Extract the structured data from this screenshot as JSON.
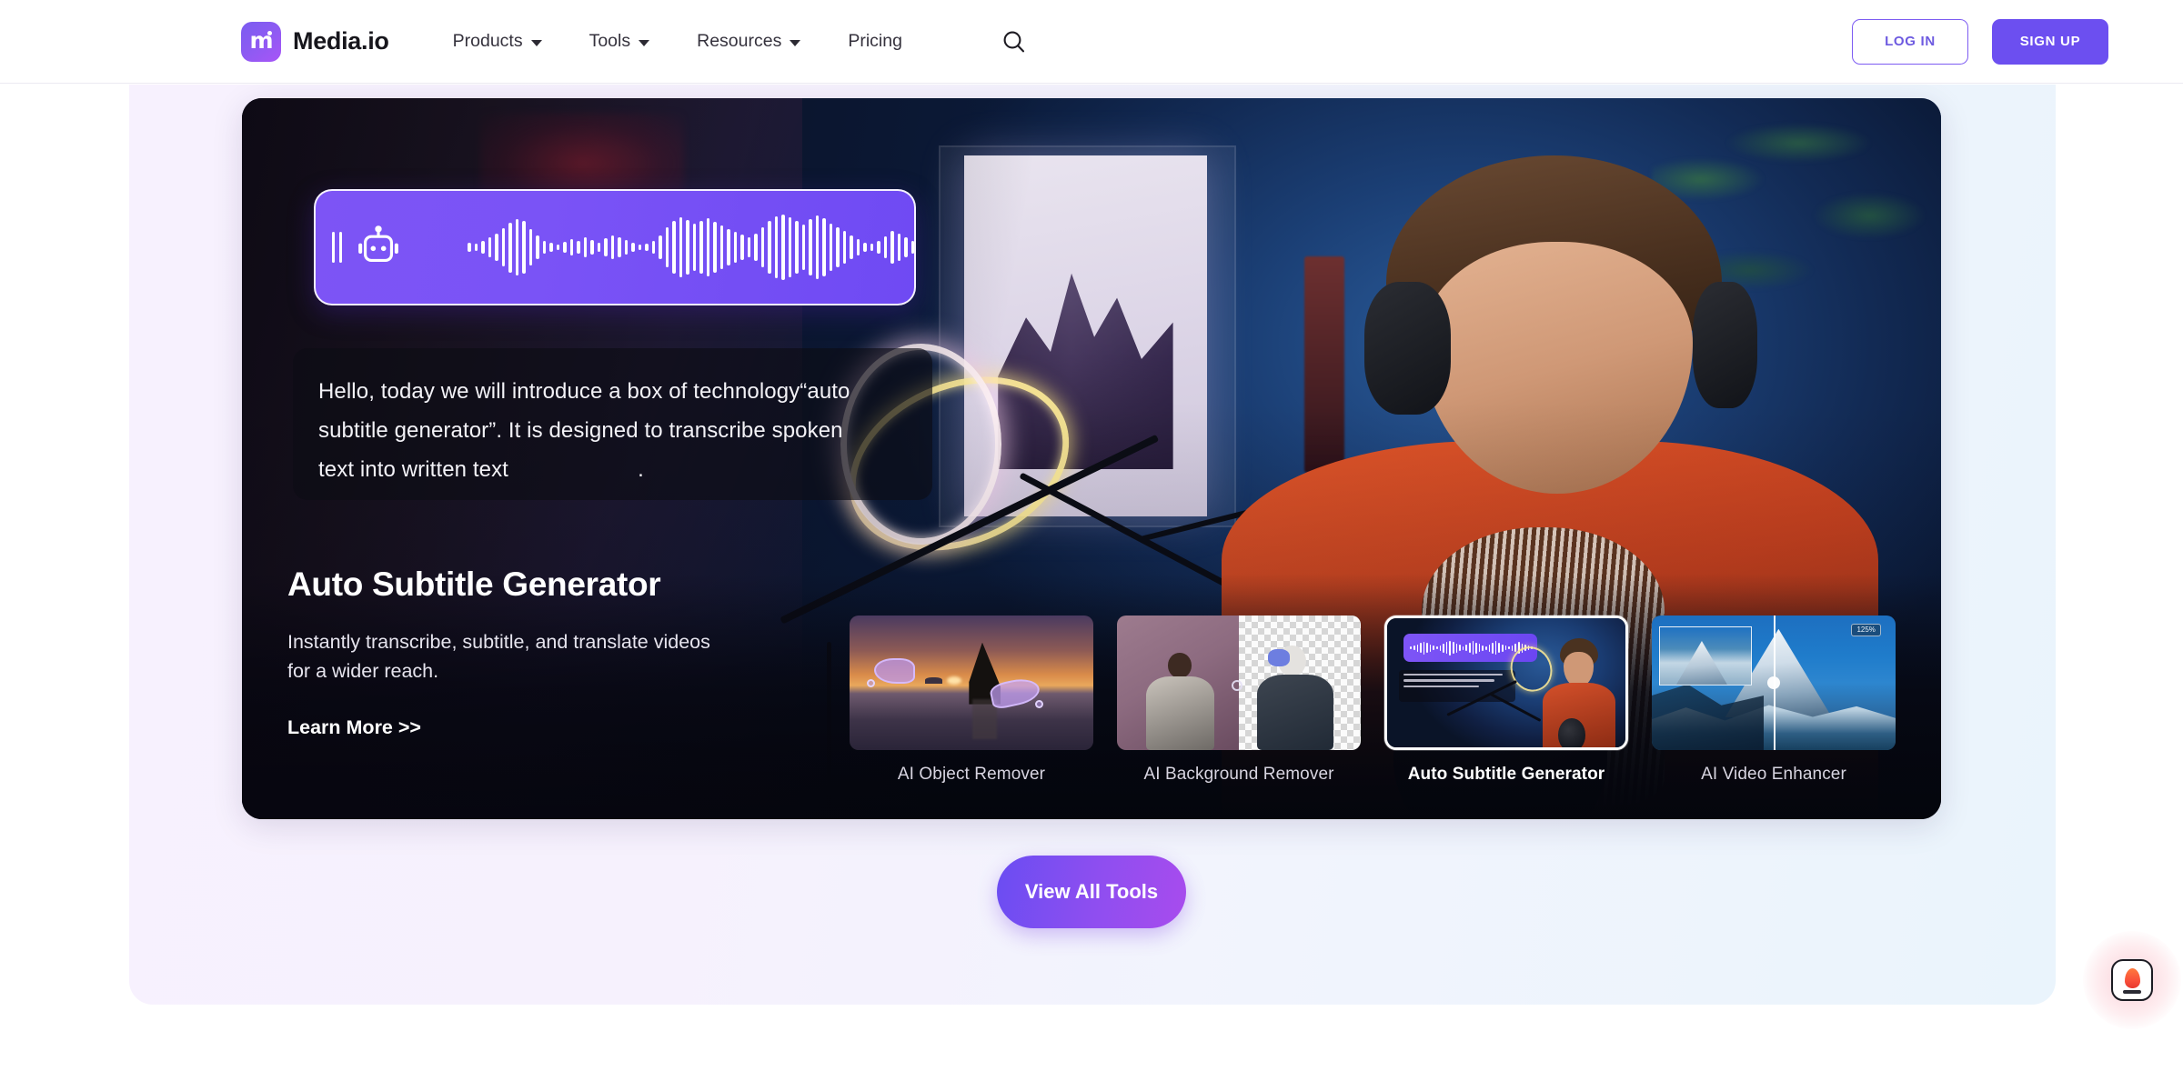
{
  "header": {
    "brand": {
      "name": "Media.io",
      "logo_icon": "media-io-logo-icon",
      "logo_letter": "m"
    },
    "nav": [
      {
        "label": "Products",
        "has_dropdown": true
      },
      {
        "label": "Tools",
        "has_dropdown": true
      },
      {
        "label": "Resources",
        "has_dropdown": true
      },
      {
        "label": "Pricing",
        "has_dropdown": false
      }
    ],
    "search_icon": "search-icon",
    "login_label": "LOG IN",
    "signup_label": "SIGN UP",
    "accent_color": "#6c4ff0",
    "login_border_color": "#7d5cf2"
  },
  "hero": {
    "waveform": {
      "robot_icon": "robot-icon",
      "card_color": "#7a53f6"
    },
    "subtitle_lines": [
      "Hello, today we will introduce a box of technology“auto",
      "subtitle generator”. It is designed to transcribe spoken",
      "text into written text                     ."
    ],
    "title": "Auto Subtitle Generator",
    "description": "Instantly transcribe, subtitle, and translate videos\nfor a wider reach.",
    "link_label": "Learn More >>"
  },
  "thumbnails": [
    {
      "caption": "AI Object Remover",
      "active": false
    },
    {
      "caption": "AI Background Remover",
      "active": false
    },
    {
      "caption": "Auto Subtitle Generator",
      "active": true
    },
    {
      "caption": "AI Video Enhancer",
      "active": false
    }
  ],
  "thumb_badges": {
    "zoom_tag": "125%"
  },
  "cta": {
    "view_all_label": "View All Tools",
    "gradient_from": "#6a4df2",
    "gradient_to": "#a84ced"
  },
  "float_widget": {
    "icon": "flame-chip-icon"
  },
  "section": {
    "bg_gradient_from": "#f7f1fe",
    "bg_gradient_to": "#eaf4fc"
  }
}
